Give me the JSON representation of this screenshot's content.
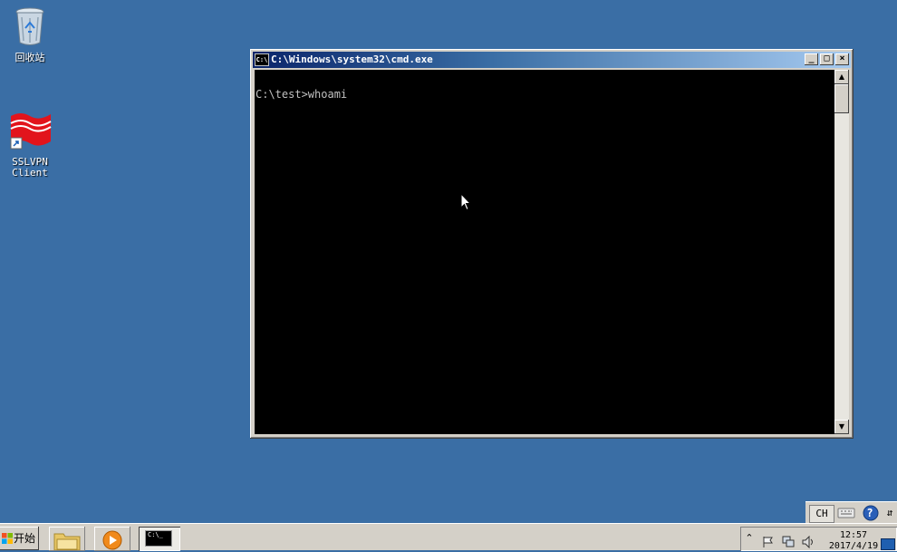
{
  "desktop": {
    "recycle_bin_label": "回收站",
    "sslvpn_label_line1": "SSLVPN",
    "sslvpn_label_line2": "Client"
  },
  "cmd_window": {
    "title": "C:\\Windows\\system32\\cmd.exe",
    "icon_text": "C:\\",
    "console_text": "C:\\test>whoami",
    "minimize_glyph": "_",
    "maximize_glyph": "□",
    "close_glyph": "×",
    "scroll_up_glyph": "▲",
    "scroll_down_glyph": "▼"
  },
  "language_bar": {
    "language": "CH",
    "keyboard_icon": "keyboard-icon",
    "help_glyph": "?",
    "options_glyph": "⇵"
  },
  "taskbar": {
    "start_label": "开始",
    "tasks": [
      {
        "name": "windows-explorer",
        "icon": "folder-icon"
      },
      {
        "name": "media-player",
        "icon": "media-player-icon"
      },
      {
        "name": "cmd",
        "icon": "console-icon",
        "icon_text": "C:\\_"
      }
    ],
    "tray": {
      "expand_glyph": "⌃",
      "clock_time": "12:57",
      "clock_date": "2017/4/19"
    }
  },
  "colors": {
    "desktop": "#3a6ea5",
    "titlebar_active": "#0a246a",
    "console_bg": "#000000",
    "console_fg": "#c0c0c0"
  }
}
